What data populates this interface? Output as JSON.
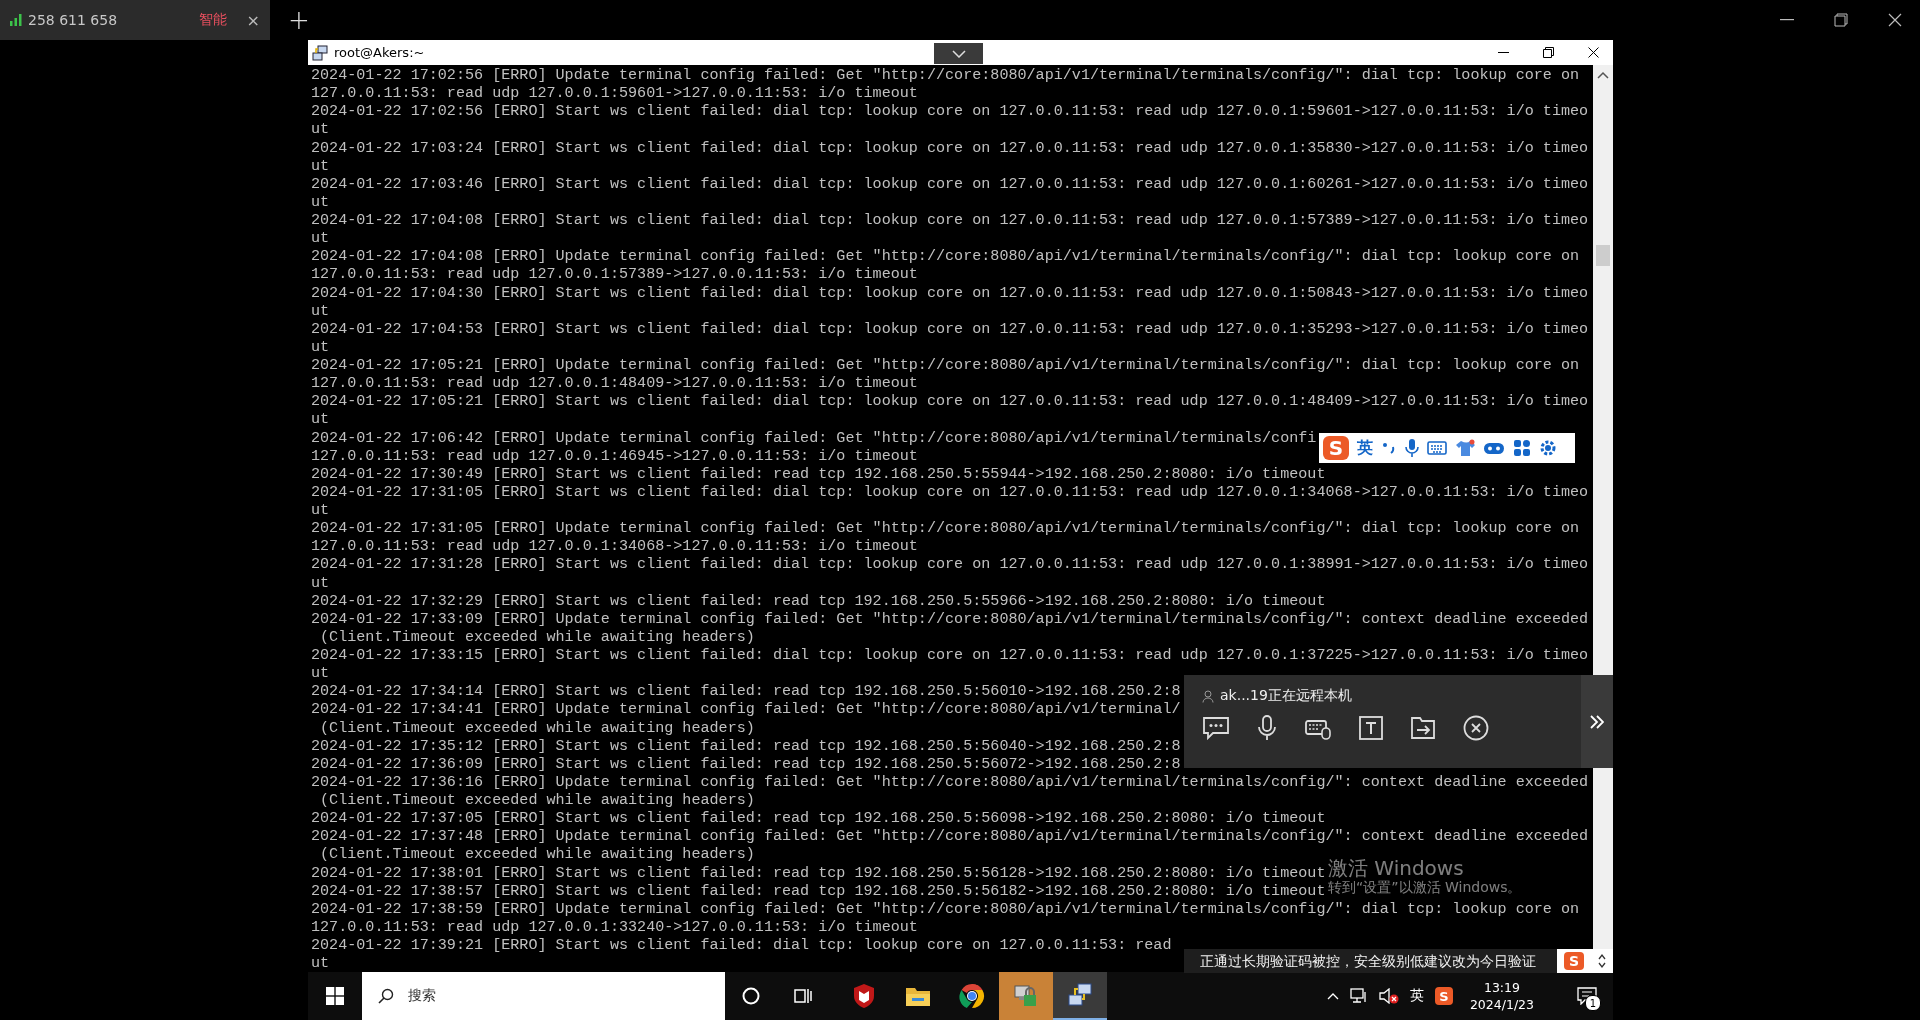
{
  "app_tab": {
    "title": "258 611 658",
    "badge": "智能",
    "close": "×",
    "selected": true
  },
  "new_tab": "+",
  "remote": {
    "window": {
      "title": "root@Akers:~"
    },
    "terminal": {
      "lines": [
        "2024-01-22 17:02:56 [ERRO] Update terminal config failed: Get \"http://core:8080/api/v1/terminal/terminals/config/\": dial tcp: lookup core on",
        "127.0.0.11:53: read udp 127.0.0.1:59601->127.0.0.11:53: i/o timeout",
        "2024-01-22 17:02:56 [ERRO] Start ws client failed: dial tcp: lookup core on 127.0.0.11:53: read udp 127.0.0.1:59601->127.0.0.11:53: i/o timeo",
        "ut",
        "2024-01-22 17:03:24 [ERRO] Start ws client failed: dial tcp: lookup core on 127.0.0.11:53: read udp 127.0.0.1:35830->127.0.0.11:53: i/o timeo",
        "ut",
        "2024-01-22 17:03:46 [ERRO] Start ws client failed: dial tcp: lookup core on 127.0.0.11:53: read udp 127.0.0.1:60261->127.0.0.11:53: i/o timeo",
        "ut",
        "2024-01-22 17:04:08 [ERRO] Start ws client failed: dial tcp: lookup core on 127.0.0.11:53: read udp 127.0.0.1:57389->127.0.0.11:53: i/o timeo",
        "ut",
        "2024-01-22 17:04:08 [ERRO] Update terminal config failed: Get \"http://core:8080/api/v1/terminal/terminals/config/\": dial tcp: lookup core on",
        "127.0.0.11:53: read udp 127.0.0.1:57389->127.0.0.11:53: i/o timeout",
        "2024-01-22 17:04:30 [ERRO] Start ws client failed: dial tcp: lookup core on 127.0.0.11:53: read udp 127.0.0.1:50843->127.0.0.11:53: i/o timeo",
        "ut",
        "2024-01-22 17:04:53 [ERRO] Start ws client failed: dial tcp: lookup core on 127.0.0.11:53: read udp 127.0.0.1:35293->127.0.0.11:53: i/o timeo",
        "ut",
        "2024-01-22 17:05:21 [ERRO] Update terminal config failed: Get \"http://core:8080/api/v1/terminal/terminals/config/\": dial tcp: lookup core on",
        "127.0.0.11:53: read udp 127.0.0.1:48409->127.0.0.11:53: i/o timeout",
        "2024-01-22 17:05:21 [ERRO] Start ws client failed: dial tcp: lookup core on 127.0.0.11:53: read udp 127.0.0.1:48409->127.0.0.11:53: i/o timeo",
        "ut",
        "2024-01-22 17:06:42 [ERRO] Update terminal config failed: Get \"http://core:8080/api/v1/terminal/terminals/confi",
        "127.0.0.11:53: read udp 127.0.0.1:46945->127.0.0.11:53: i/o timeout",
        "2024-01-22 17:30:49 [ERRO] Start ws client failed: read tcp 192.168.250.5:55944->192.168.250.2:8080: i/o timeout",
        "2024-01-22 17:31:05 [ERRO] Start ws client failed: dial tcp: lookup core on 127.0.0.11:53: read udp 127.0.0.1:34068->127.0.0.11:53: i/o timeo",
        "ut",
        "2024-01-22 17:31:05 [ERRO] Update terminal config failed: Get \"http://core:8080/api/v1/terminal/terminals/config/\": dial tcp: lookup core on",
        "127.0.0.11:53: read udp 127.0.0.1:34068->127.0.0.11:53: i/o timeout",
        "2024-01-22 17:31:28 [ERRO] Start ws client failed: dial tcp: lookup core on 127.0.0.11:53: read udp 127.0.0.1:38991->127.0.0.11:53: i/o timeo",
        "ut",
        "2024-01-22 17:32:29 [ERRO] Start ws client failed: read tcp 192.168.250.5:55966->192.168.250.2:8080: i/o timeout",
        "2024-01-22 17:33:09 [ERRO] Update terminal config failed: Get \"http://core:8080/api/v1/terminal/terminals/config/\": context deadline exceeded",
        " (Client.Timeout exceeded while awaiting headers)",
        "2024-01-22 17:33:15 [ERRO] Start ws client failed: dial tcp: lookup core on 127.0.0.11:53: read udp 127.0.0.1:37225->127.0.0.11:53: i/o timeo",
        "ut",
        "2024-01-22 17:34:14 [ERRO] Start ws client failed: read tcp 192.168.250.5:56010->192.168.250.2:8",
        "2024-01-22 17:34:41 [ERRO] Update terminal config failed: Get \"http://core:8080/api/v1/terminal/",
        " (Client.Timeout exceeded while awaiting headers)",
        "2024-01-22 17:35:12 [ERRO] Start ws client failed: read tcp 192.168.250.5:56040->192.168.250.2:8",
        "2024-01-22 17:36:09 [ERRO] Start ws client failed: read tcp 192.168.250.5:56072->192.168.250.2:8",
        "2024-01-22 17:36:16 [ERRO] Update terminal config failed: Get \"http://core:8080/api/v1/terminal/terminals/config/\": context deadline exceeded",
        " (Client.Timeout exceeded while awaiting headers)",
        "2024-01-22 17:37:05 [ERRO] Start ws client failed: read tcp 192.168.250.5:56098->192.168.250.2:8080: i/o timeout",
        "2024-01-22 17:37:48 [ERRO] Update terminal config failed: Get \"http://core:8080/api/v1/terminal/terminals/config/\": context deadline exceeded",
        " (Client.Timeout exceeded while awaiting headers)",
        "2024-01-22 17:38:01 [ERRO] Start ws client failed: read tcp 192.168.250.5:56128->192.168.250.2:8080: i/o timeout",
        "2024-01-22 17:38:57 [ERRO] Start ws client failed: read tcp 192.168.250.5:56182->192.168.250.2:8080: i/o timeout",
        "2024-01-22 17:38:59 [ERRO] Update terminal config failed: Get \"http://core:8080/api/v1/terminal/terminals/config/\": dial tcp: lookup core on",
        "127.0.0.11:53: read udp 127.0.0.1:33240->127.0.0.11:53: i/o timeout",
        "2024-01-22 17:39:21 [ERRO] Start ws client failed: dial tcp: lookup core on 127.0.0.11:53: read",
        "ut"
      ]
    },
    "ime_toolbar": {
      "logo": "S",
      "mode": "英"
    },
    "remote_panel": {
      "status": "ak...19正在远程本机"
    },
    "activation": {
      "title": "激活 Windows",
      "hint": "转到“设置”以激活 Windows。"
    },
    "notification": {
      "text": "正通过长期验证码被控，安全级别低建议改为今日验证",
      "logo": "S"
    },
    "taskbar": {
      "search_placeholder": "搜索",
      "apps": [
        {
          "kind": "cortana",
          "flashing": false,
          "active": false
        },
        {
          "kind": "task-view",
          "flashing": false,
          "active": false
        },
        {
          "kind": "shield",
          "flashing": false,
          "active": false
        },
        {
          "kind": "folder",
          "flashing": false,
          "active": false
        },
        {
          "kind": "browser",
          "flashing": false,
          "active": false
        },
        {
          "kind": "padlock",
          "flashing": true,
          "active": false
        },
        {
          "kind": "computers",
          "flashing": false,
          "active": true
        }
      ],
      "volume_muted": true,
      "ime": "英",
      "ime_logo": "S",
      "time": "13:19",
      "date": "2024/1/23",
      "notification_count": "1"
    }
  }
}
